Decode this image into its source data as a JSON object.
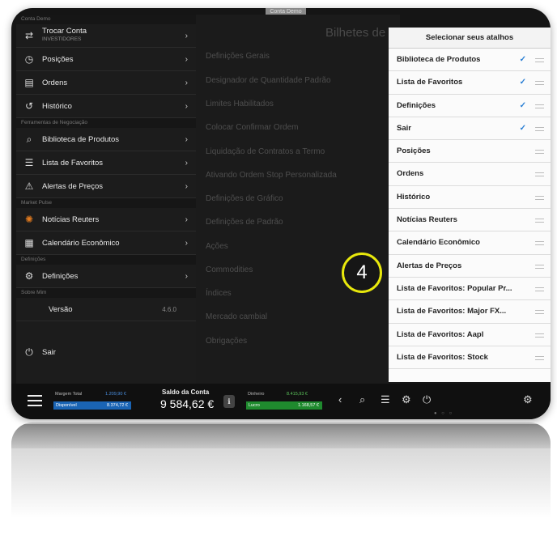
{
  "header": {
    "demo_label": "Conta Demo"
  },
  "sidebar": {
    "section_account": "Conta Demo",
    "switch_account": {
      "label": "Trocar Conta",
      "sub": "INVESTIDORES"
    },
    "items_top": [
      {
        "label": "Posições",
        "icon": "clock-icon"
      },
      {
        "label": "Ordens",
        "icon": "list-icon"
      },
      {
        "label": "Histórico",
        "icon": "history-icon"
      }
    ],
    "section_tools": "Ferramentas de Negociação",
    "items_tools": [
      {
        "label": "Biblioteca de Produtos",
        "icon": "search-icon"
      },
      {
        "label": "Lista de Favoritos",
        "icon": "list-icon"
      },
      {
        "label": "Alertas de Preços",
        "icon": "alert-icon"
      }
    ],
    "section_market": "Market Pulse",
    "items_market": [
      {
        "label": "Notícias Reuters",
        "icon": "reuters-icon"
      },
      {
        "label": "Calendário Econômico",
        "icon": "calendar-icon"
      }
    ],
    "section_settings": "Definições",
    "settings_item": {
      "label": "Definições",
      "icon": "gear-icon"
    },
    "section_about": "Sobre Mim",
    "version_label": "Versão",
    "version_value": "4.6.0",
    "exit_label": "Sair"
  },
  "main": {
    "title": "Bilhetes de Ordem",
    "items": [
      "Definições Gerais",
      "Designador de Quantidade Padrão",
      "Limites Habilitados",
      "Colocar Confirmar Ordem",
      "Liquidação de Contratos a Termo",
      "Ativando Ordem Stop Personalizada",
      "Definições de Gráfico",
      "Definições de Padrão",
      "Ações",
      "Commodities",
      "Índices",
      "Mercado cambial",
      "Obrigações"
    ]
  },
  "marker": {
    "number": "4",
    "color": "#e8e80c"
  },
  "shortcuts": {
    "title": "Selecionar seus atalhos",
    "check_color": "#2a7fd4",
    "items": [
      {
        "label": "Biblioteca de Produtos",
        "checked": true
      },
      {
        "label": "Lista de Favoritos",
        "checked": true
      },
      {
        "label": "Definições",
        "checked": true
      },
      {
        "label": "Sair",
        "checked": true
      },
      {
        "label": "Posições",
        "checked": false
      },
      {
        "label": "Ordens",
        "checked": false
      },
      {
        "label": "Histórico",
        "checked": false
      },
      {
        "label": "Notícias Reuters",
        "checked": false
      },
      {
        "label": "Calendário Econômico",
        "checked": false
      },
      {
        "label": "Alertas de Preços",
        "checked": false
      },
      {
        "label": "Lista de Favoritos: Popular Pr...",
        "checked": false
      },
      {
        "label": "Lista de Favoritos: Major FX...",
        "checked": false
      },
      {
        "label": "Lista de Favoritos: Aapl",
        "checked": false
      },
      {
        "label": "Lista de Favoritos: Stock",
        "checked": false
      }
    ]
  },
  "bottom": {
    "margin_label": "Margem Total",
    "margin_value": "1.209,90 €",
    "available_label": "Disponível",
    "available_value": "8.374,72 €",
    "balance_label": "Saldo da Conta",
    "balance_value": "9 584,62 €",
    "money_label": "Dinheiro",
    "money_value": "8.415,93 €",
    "profit_label": "Lucro",
    "profit_value": "1.168,57 €",
    "available_color": "#1a64b4",
    "profit_color": "#1f8a2e"
  }
}
